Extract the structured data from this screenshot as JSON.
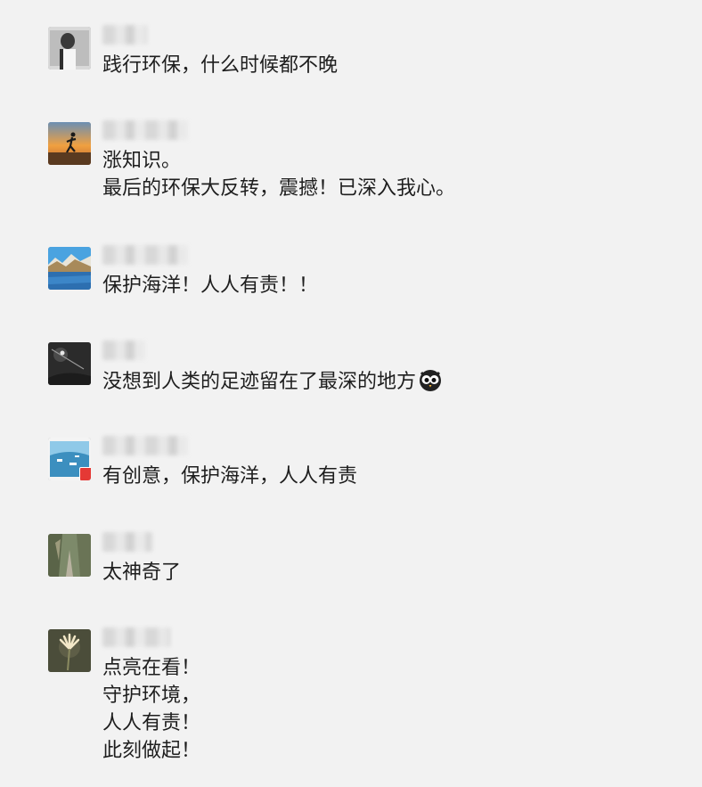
{
  "comments": [
    {
      "avatar": "avatar-portrait-person",
      "name_blur_width": 50,
      "lines": [
        "践行环保，什么时候都不晚"
      ]
    },
    {
      "avatar": "avatar-runner-sunset",
      "name_blur_width": 96,
      "lines": [
        "涨知识。",
        "最后的环保大反转，震撼！已深入我心。"
      ]
    },
    {
      "avatar": "avatar-mountain-lake",
      "name_blur_width": 96,
      "lines": [
        "保护海洋！人人有责！！"
      ]
    },
    {
      "avatar": "avatar-dark-night",
      "name_blur_width": 48,
      "lines": [
        "没想到人类的足迹留在了最深的地方"
      ],
      "emoji": "owl-emoji-icon"
    },
    {
      "avatar": "avatar-coast-boats",
      "name_blur_width": 96,
      "lines": [
        "有创意，保护海洋，人人有责"
      ]
    },
    {
      "avatar": "avatar-forest-path",
      "name_blur_width": 56,
      "lines": [
        "太神奇了"
      ]
    },
    {
      "avatar": "avatar-flower",
      "name_blur_width": 76,
      "lines": [
        "点亮在看！",
        "守护环境，",
        "人人有责！",
        "此刻做起！"
      ]
    }
  ]
}
